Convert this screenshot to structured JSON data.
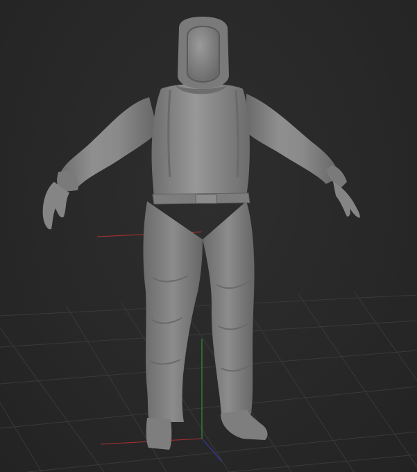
{
  "viewport": {
    "background_color": "#262626",
    "grid_color": "#3a3a3a",
    "model_color": "#8a8a8a"
  },
  "axes": {
    "x_axis_color": "#b03030",
    "y_axis_color": "#3aa03a",
    "z_axis_color": "#3a3ab8"
  },
  "model": {
    "icon": "hazmat-suit-figure"
  }
}
